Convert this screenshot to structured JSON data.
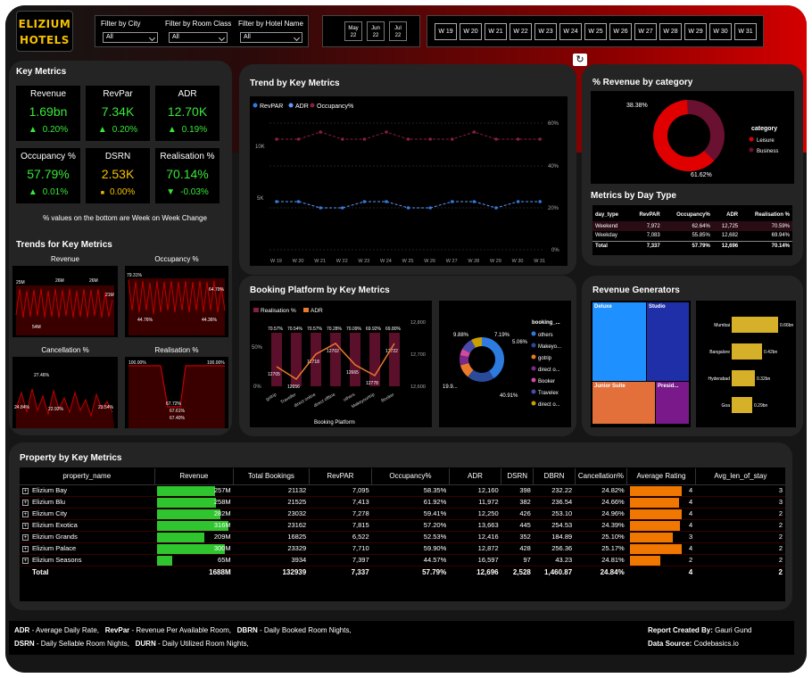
{
  "brand": {
    "line1": "ELIZIUM",
    "line2": "HOTELS"
  },
  "filters": [
    {
      "label": "Filter by City",
      "value": "All"
    },
    {
      "label": "Filter by Room Class",
      "value": "All"
    },
    {
      "label": "Filter by Hotel Name",
      "value": "All"
    }
  ],
  "months": [
    {
      "m": "May",
      "y": "22"
    },
    {
      "m": "Jun",
      "y": "22"
    },
    {
      "m": "Jul",
      "y": "22"
    }
  ],
  "weeks": [
    "W 19",
    "W 20",
    "W 21",
    "W 22",
    "W 23",
    "W 24",
    "W 25",
    "W 26",
    "W 27",
    "W 28",
    "W 29",
    "W 30",
    "W 31"
  ],
  "key_metrics": {
    "title": "Key Metrics",
    "note": "% values on the bottom are Week on Week Change",
    "cards": [
      {
        "label": "Revenue",
        "value": "1.69bn",
        "arrow": "▲",
        "change": "0.20%",
        "kind": "up"
      },
      {
        "label": "RevPar",
        "value": "7.34K",
        "arrow": "▲",
        "change": "0.20%",
        "kind": "up"
      },
      {
        "label": "ADR",
        "value": "12.70K",
        "arrow": "▲",
        "change": "0.19%",
        "kind": "up"
      },
      {
        "label": "Occupancy %",
        "value": "57.79%",
        "arrow": "▲",
        "change": "0.01%",
        "kind": "up"
      },
      {
        "label": "DSRN",
        "value": "2.53K",
        "arrow": "■",
        "change": "0.00%",
        "kind": "flat"
      },
      {
        "label": "Realisation %",
        "value": "70.14%",
        "arrow": "▼",
        "change": "-0.03%",
        "kind": "down"
      }
    ]
  },
  "trends": {
    "title": "Trends for Key Metrics",
    "revenue": {
      "title": "Revenue",
      "labels": [
        "25M",
        "26M",
        "26M",
        "21M",
        "54M"
      ]
    },
    "occupancy": {
      "title": "Occupancy %",
      "labels": [
        "79.31%",
        "64.79%",
        "44.76%",
        "44.36%"
      ]
    },
    "cancellation": {
      "title": "Cancellation %",
      "labels": [
        "27.46%",
        "24.84%",
        "22.92%",
        "23.54%"
      ]
    },
    "realisation": {
      "title": "Realisation %",
      "labels": [
        "100.00%",
        "100.00%",
        "67.72%",
        "67.61%",
        "67.40%"
      ]
    }
  },
  "trend_chart": {
    "title": "Trend by Key Metrics",
    "legend": [
      "RevPAR",
      "ADR",
      "Occupancy%"
    ],
    "left_ticks": [
      "10K",
      "5K"
    ],
    "right_ticks": [
      "60%",
      "40%",
      "20%",
      "0%"
    ],
    "colors": {
      "revpar": "#2e7be0",
      "adr": "#6699ff",
      "occ": "#8a1f3a"
    }
  },
  "booking": {
    "title": "Booking Platform by Key Metrics",
    "legend": [
      "Realisation %",
      "ADR"
    ],
    "bar_labels": [
      "70.57%",
      "70.54%",
      "70.57%",
      "70.28%",
      "70.09%",
      "69.92%",
      "69.80%"
    ],
    "adr_labels": [
      "12705",
      "12656",
      "12718",
      "12702",
      "12665",
      "12778",
      "12722"
    ],
    "categories": [
      "gotrip",
      "Traveller",
      "direct online",
      "direct offline",
      "others",
      "Makeyourtrip",
      "Booker"
    ],
    "left_ticks": [
      "50%",
      "0%"
    ],
    "right_ticks": [
      "12,800",
      "12,700",
      "12,600"
    ],
    "xlabel": "Booking Platform",
    "donut_labels": [
      "9.88%",
      "7.19%",
      "5.06%",
      "19.9...",
      "40.91%"
    ],
    "legend_title": "booking_...",
    "legend_items": [
      "others",
      "Makeyo...",
      "gotrip",
      "direct o...",
      "Booker",
      "Travelex",
      "direct o..."
    ],
    "donut_colors": [
      "#2e7be0",
      "#2a4a9a",
      "#e87a2a",
      "#7a2a8a",
      "#d04aa0",
      "#4a4aaa",
      "#c8a000"
    ]
  },
  "rev_category": {
    "title": "% Revenue by category",
    "legend_title": "category",
    "items": [
      {
        "name": "Leisure",
        "pct": "61.62%",
        "color": "#e00000"
      },
      {
        "name": "Business",
        "pct": "38.38%",
        "color": "#6a1030"
      }
    ]
  },
  "day_type": {
    "title": "Metrics by Day Type",
    "headers": [
      "day_type",
      "RevPAR",
      "Occupancy%",
      "ADR",
      "Realisation %"
    ],
    "rows": [
      [
        "Weekend",
        "7,972",
        "62.64%",
        "12,725",
        "70.59%"
      ],
      [
        "Weekday",
        "7,083",
        "55.85%",
        "12,682",
        "69.94%"
      ]
    ],
    "total": [
      "Total",
      "7,337",
      "57.79%",
      "12,696",
      "70.14%"
    ]
  },
  "generators": {
    "title": "Revenue Generators",
    "tiles": [
      "Deluxe",
      "Studio",
      "Junior Suite",
      "Presid..."
    ],
    "cities": [
      {
        "name": "Mumbai",
        "value": "0.66bn"
      },
      {
        "name": "Bangalore",
        "value": "0.42bn"
      },
      {
        "name": "Hyderabad",
        "value": "0.32bn"
      },
      {
        "name": "Goa",
        "value": "0.29bn"
      }
    ]
  },
  "property": {
    "title": "Property by Key Metrics",
    "headers": [
      "property_name",
      "Revenue",
      "Total Bookings",
      "RevPAR",
      "Occupancy%",
      "ADR",
      "DSRN",
      "DBRN",
      "Cancellation%",
      "Average Rating",
      "Avg_len_of_stay"
    ],
    "rows": [
      [
        "Elizium Bay",
        "257M",
        "21132",
        "7,095",
        "58.35%",
        "12,160",
        "398",
        "232.22",
        "24.82%",
        "4",
        "3"
      ],
      [
        "Elizium Blu",
        "258M",
        "21525",
        "7,413",
        "61.92%",
        "11,972",
        "382",
        "236.54",
        "24.66%",
        "4",
        "3"
      ],
      [
        "Elizium City",
        "282M",
        "23032",
        "7,278",
        "59.41%",
        "12,250",
        "426",
        "253.10",
        "24.96%",
        "4",
        "2"
      ],
      [
        "Elizium Exotica",
        "316M",
        "23162",
        "7,815",
        "57.20%",
        "13,663",
        "445",
        "254.53",
        "24.39%",
        "4",
        "2"
      ],
      [
        "Elizium Grands",
        "209M",
        "16825",
        "6,522",
        "52.53%",
        "12,416",
        "352",
        "184.89",
        "25.10%",
        "3",
        "2"
      ],
      [
        "Elizium Palace",
        "300M",
        "23329",
        "7,710",
        "59.90%",
        "12,872",
        "428",
        "256.36",
        "25.17%",
        "4",
        "2"
      ],
      [
        "Elizium Seasons",
        "65M",
        "3934",
        "7,397",
        "44.57%",
        "16,597",
        "97",
        "43.23",
        "24.81%",
        "2",
        "2"
      ]
    ],
    "revenue_frac": [
      0.81,
      0.82,
      0.89,
      1.0,
      0.66,
      0.95,
      0.21
    ],
    "rating_frac": [
      0.93,
      0.89,
      0.93,
      0.91,
      0.77,
      0.93,
      0.55
    ],
    "total": [
      "Total",
      "1688M",
      "132939",
      "7,337",
      "57.79%",
      "12,696",
      "2,528",
      "1,460.87",
      "24.84%",
      "4",
      "2"
    ]
  },
  "footer": {
    "n1k": "ADR",
    "n1": " - Average Daily Rate,",
    "n2k": "RevPar",
    "n2": " - Revenue Per Available Room,",
    "n3k": "DBRN",
    "n3": " - Daily Booked Room Nights,",
    "n4k": "DSRN",
    "n4": " - Daily Sellable Room Nights,",
    "n5k": "DURN",
    "n5": " - Daily Utilized Room Nights,",
    "by_k": "Report Created By:",
    "by": " Gauri Gund",
    "src_k": "Data Source:",
    "src": " Codebasics.io"
  }
}
